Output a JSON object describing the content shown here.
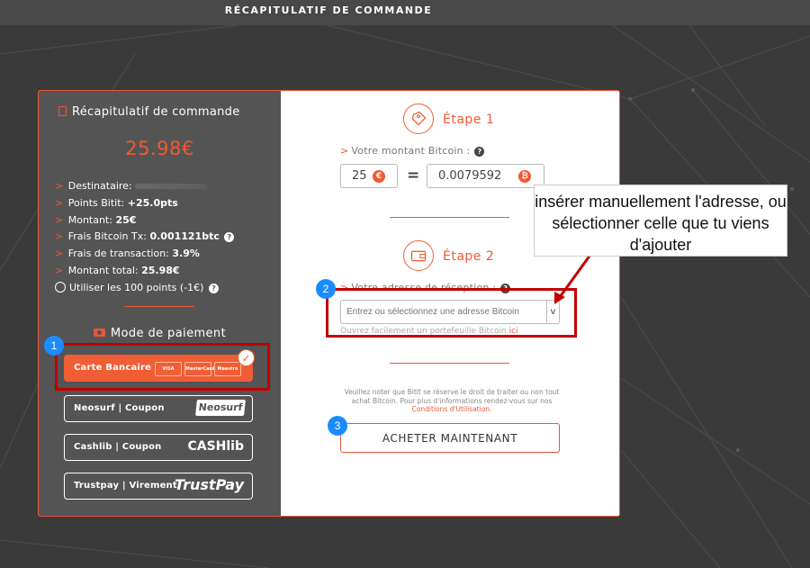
{
  "header": {
    "title": "RÉCAPITULATIF DE COMMANDE"
  },
  "summary": {
    "title": "Récapitulatif de commande",
    "total_display": "25.98€",
    "rows": [
      {
        "label": "Destinataire:",
        "value": ""
      },
      {
        "label": "Points Bitit:",
        "value": "+25.0pts"
      },
      {
        "label": "Montant:",
        "value": "25€"
      },
      {
        "label": "Frais Bitcoin Tx:",
        "value": "0.001121btc"
      },
      {
        "label": "Frais de transaction:",
        "value": "3.9%"
      },
      {
        "label": "Montant total:",
        "value": "25.98€"
      }
    ],
    "points_option": "Utiliser les 100 points (-1€)"
  },
  "payment": {
    "title": "Mode de paiement",
    "methods": [
      {
        "label": "Carte Bancaire",
        "logos": [
          "VISA",
          "MasterCard",
          "Maestro"
        ],
        "selected": true
      },
      {
        "label": "Neosurf | Coupon",
        "logo": "Neosurf"
      },
      {
        "label": "Cashlib | Coupon",
        "logo": "CASHlib"
      },
      {
        "label": "Trustpay | Virement",
        "logo": "TrustPay"
      }
    ]
  },
  "step1": {
    "title": "Étape 1",
    "label": "Votre montant Bitcoin :",
    "eur_value": "25",
    "equals": "=",
    "btc_value": "0.0079592",
    "eur_symbol": "€",
    "btc_symbol": "₿"
  },
  "step2": {
    "title": "Étape 2",
    "label": "Votre adresse de réception :",
    "address_placeholder": "Entrez ou sélectionnez une adresse Bitcoin",
    "dropdown_symbol": "v",
    "wallet_text": "Ouvrez facilement un portefeuille Bitcoin",
    "wallet_link": "ici"
  },
  "notice": {
    "text": "Veuillez noter que Bitit se réserve le droit de traiter ou non tout achat Bitcoin. Pour plus d'informations rendez-vous sur nos",
    "link": "Conditions d'Utilisation."
  },
  "buy_button": "ACHETER MAINTENANT",
  "annotations": {
    "callout": "insérer manuellement l'adresse, ou sélectionner celle que tu viens d'ajouter",
    "badges": [
      "1",
      "2",
      "3"
    ],
    "highlight_color": "#c00000",
    "badge_color": "#1a8cff"
  },
  "colors": {
    "accent": "#f05a32",
    "left_panel": "#545454",
    "background": "#3a3a3a"
  }
}
